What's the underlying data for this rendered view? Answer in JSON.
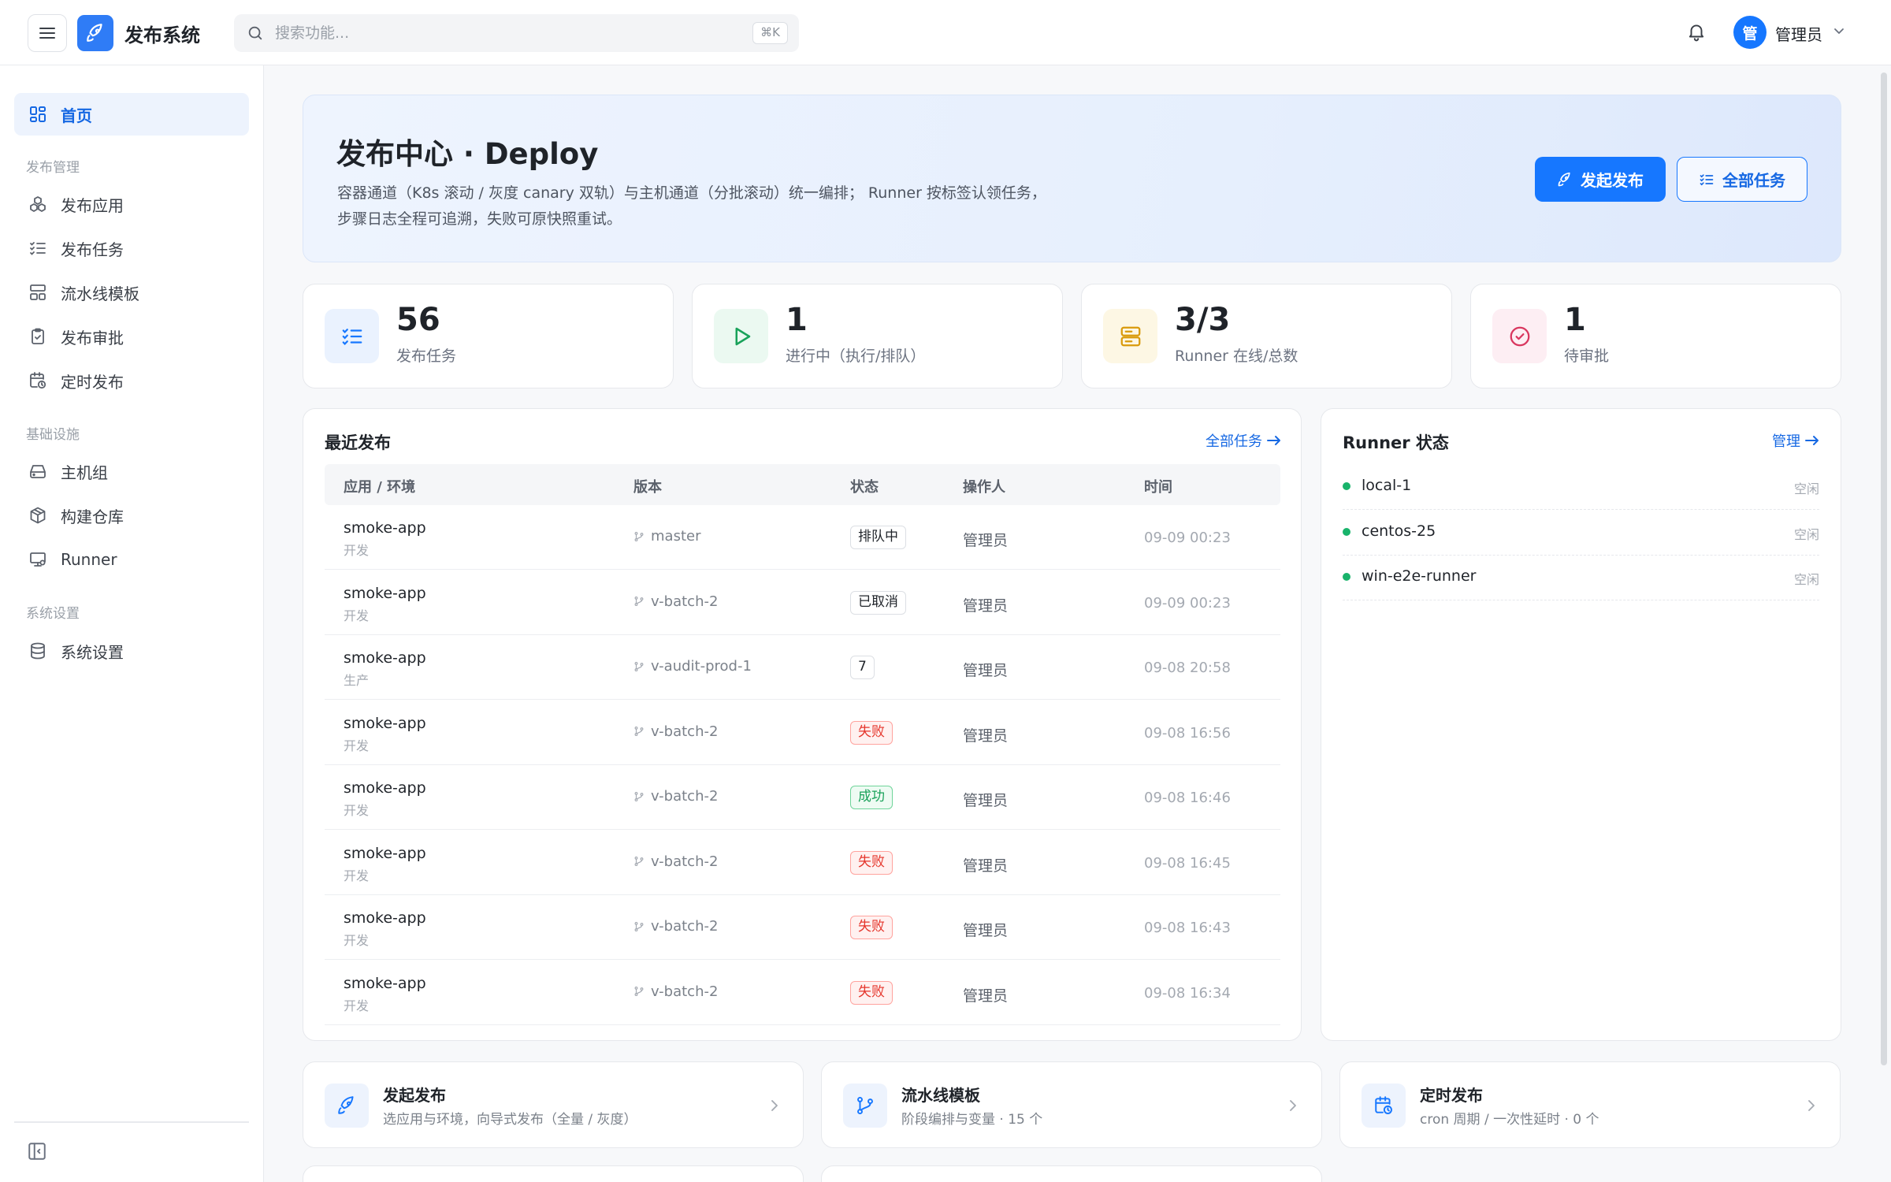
{
  "header": {
    "app_title": "发布系统",
    "search_placeholder": "搜索功能...",
    "search_shortcut": "⌘K",
    "avatar_text": "管",
    "user_name": "管理员"
  },
  "sidebar": {
    "home": "首页",
    "group_release": "发布管理",
    "release_items": [
      "发布应用",
      "发布任务",
      "流水线模板",
      "发布审批",
      "定时发布"
    ],
    "group_infra": "基础设施",
    "infra_items": [
      "主机组",
      "构建仓库",
      "Runner"
    ],
    "group_system": "系统设置",
    "system_items": [
      "系统设置"
    ]
  },
  "hero": {
    "title": "发布中心 · Deploy",
    "desc_line1": "容器通道（K8s 滚动 / 灰度 canary 双轨）与主机通道（分批滚动）统一编排； Runner 按标签认领任务，",
    "desc_line2": "步骤日志全程可追溯，失败可原快照重试。",
    "btn_start": "发起发布",
    "btn_all": "全部任务"
  },
  "stats": [
    {
      "value": "56",
      "label": "发布任务"
    },
    {
      "value": "1",
      "label": "进行中（执行/排队）"
    },
    {
      "value": "3/3",
      "label": "Runner 在线/总数"
    },
    {
      "value": "1",
      "label": "待审批"
    }
  ],
  "recent": {
    "title": "最近发布",
    "link": "全部任务",
    "columns": [
      "应用 / 环境",
      "版本",
      "状态",
      "操作人",
      "时间"
    ],
    "rows": [
      {
        "app": "smoke-app",
        "env": "开发",
        "version": "master",
        "status": "排队中",
        "kind": "neutral",
        "operator": "管理员",
        "time": "09-09 00:23"
      },
      {
        "app": "smoke-app",
        "env": "开发",
        "version": "v-batch-2",
        "status": "已取消",
        "kind": "neutral",
        "operator": "管理员",
        "time": "09-09 00:23"
      },
      {
        "app": "smoke-app",
        "env": "生产",
        "version": "v-audit-prod-1",
        "status": "7",
        "kind": "neutral",
        "operator": "管理员",
        "time": "09-08 20:58"
      },
      {
        "app": "smoke-app",
        "env": "开发",
        "version": "v-batch-2",
        "status": "失败",
        "kind": "fail",
        "operator": "管理员",
        "time": "09-08 16:56"
      },
      {
        "app": "smoke-app",
        "env": "开发",
        "version": "v-batch-2",
        "status": "成功",
        "kind": "ok",
        "operator": "管理员",
        "time": "09-08 16:46"
      },
      {
        "app": "smoke-app",
        "env": "开发",
        "version": "v-batch-2",
        "status": "失败",
        "kind": "fail",
        "operator": "管理员",
        "time": "09-08 16:45"
      },
      {
        "app": "smoke-app",
        "env": "开发",
        "version": "v-batch-2",
        "status": "失败",
        "kind": "fail",
        "operator": "管理员",
        "time": "09-08 16:43"
      },
      {
        "app": "smoke-app",
        "env": "开发",
        "version": "v-batch-2",
        "status": "失败",
        "kind": "fail",
        "operator": "管理员",
        "time": "09-08 16:34"
      }
    ]
  },
  "runners": {
    "title": "Runner 状态",
    "link": "管理",
    "items": [
      {
        "name": "local-1",
        "status": "空闲"
      },
      {
        "name": "centos-25",
        "status": "空闲"
      },
      {
        "name": "win-e2e-runner",
        "status": "空闲"
      }
    ]
  },
  "quick": [
    {
      "title": "发起发布",
      "desc": "选应用与环境，向导式发布（全量 / 灰度）"
    },
    {
      "title": "流水线模板",
      "desc": "阶段编排与变量 · 15 个"
    },
    {
      "title": "定时发布",
      "desc": "cron 周期 / 一次性延时 · 0 个"
    }
  ],
  "colors": {
    "accent": "#1677ff",
    "success": "#19a25a",
    "danger": "#e5352b",
    "runner_online": "#19b36b"
  }
}
